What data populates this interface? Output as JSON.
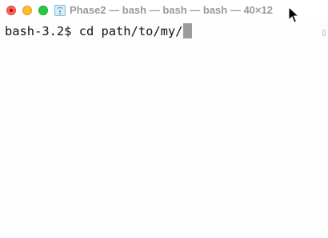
{
  "window": {
    "title": "Phase2 — bash — bash — bash — 40×12"
  },
  "terminal": {
    "prompt": "bash-3.2$",
    "command": "cd path/to/my/"
  },
  "icons": {
    "close": "close-button-icon",
    "minimize": "minimize-button-icon",
    "zoom": "zoom-button-icon",
    "document": "folder-proxy-icon",
    "pointer": "mouse-pointer-icon"
  },
  "colors": {
    "close": "#fe5f57",
    "minimize": "#febc2e",
    "zoom": "#28c840",
    "title_text": "#9a9a9a",
    "caret": "#9c9c9c"
  }
}
